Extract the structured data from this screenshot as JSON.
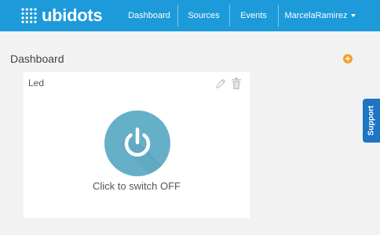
{
  "header": {
    "brand": "ubidots",
    "nav": [
      {
        "label": "Dashboard"
      },
      {
        "label": "Sources"
      },
      {
        "label": "Events"
      }
    ],
    "user_menu_label": "MarcelaRamirez"
  },
  "page": {
    "title": "Dashboard"
  },
  "widget": {
    "title": "Led",
    "caption": "Click to switch OFF"
  },
  "support_label": "Support",
  "colors": {
    "header_bg": "#1d9ad9",
    "switch_bg": "#66afc9",
    "add_accent": "#f0a12a",
    "support_bg": "#1d75c4"
  },
  "icons": [
    "ubidots-logo-icon",
    "plus-icon",
    "pencil-icon",
    "trash-icon",
    "power-icon",
    "chevron-down-icon"
  ]
}
